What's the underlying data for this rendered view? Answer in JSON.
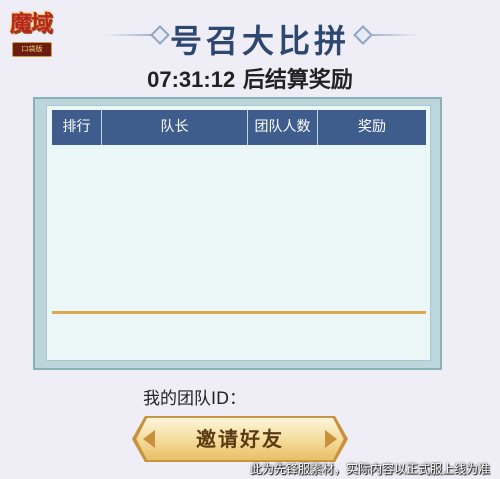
{
  "logo": {
    "title": "魔域",
    "subtitle": "口袋版"
  },
  "title": "号召大比拼",
  "timer": {
    "time": "07:31:12",
    "suffix": " 后结算奖励"
  },
  "table": {
    "headers": [
      "排行",
      "队长",
      "团队人数",
      "奖励"
    ],
    "rows": []
  },
  "team_id_label": "我的团队ID：",
  "invite_button": "邀请好友",
  "disclaimer": "此为先锋服素材，实际内容以正式服上线为准",
  "colors": {
    "header_bg": "#3e5d8d",
    "title": "#2e4770",
    "accent_gold": "#d8a94f",
    "panel_bg": "#ebf7f6"
  }
}
